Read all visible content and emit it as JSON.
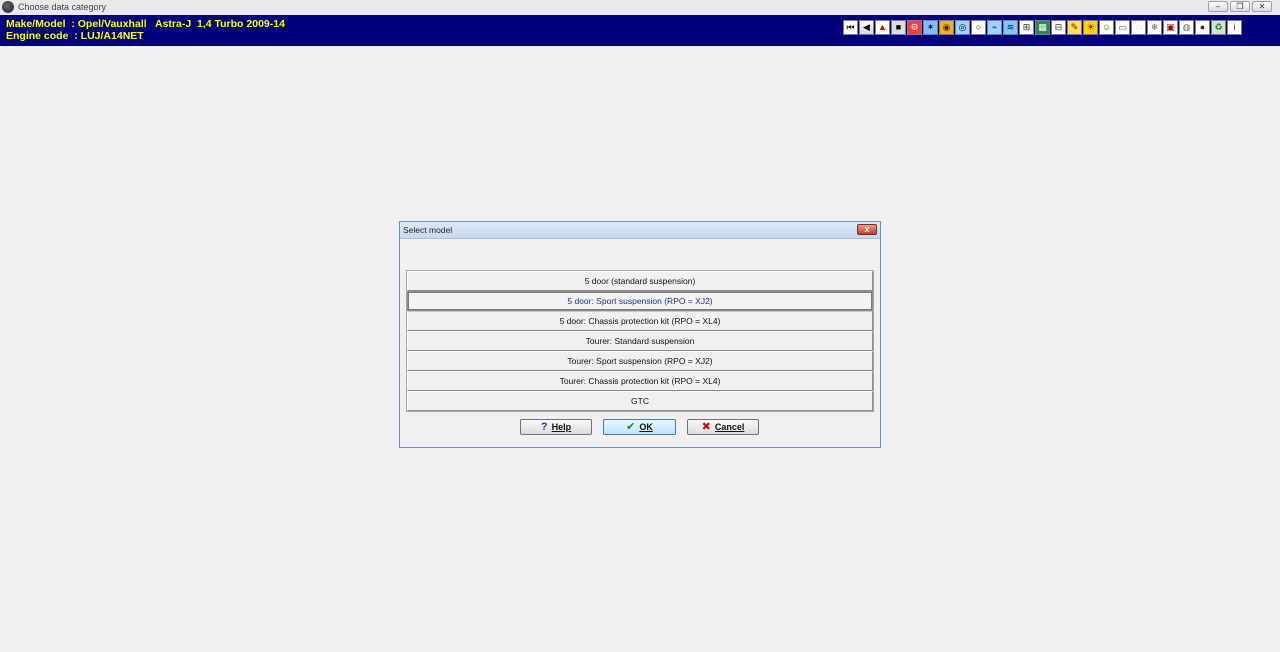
{
  "window": {
    "title": "Choose data category",
    "controls": [
      "minimize",
      "restore",
      "close"
    ]
  },
  "header": {
    "make_model_line": "Make/Model  : Opel/Vauxhall   Astra-J  1,4 Turbo 2009-14",
    "engine_code_line": "Engine code  : LUJ/A14NET"
  },
  "toolbar": {
    "icons": [
      "first-page-icon",
      "previous-icon",
      "warning-icon",
      "brakes-icon",
      "engine-icon",
      "ignition-icon",
      "fuel-icon",
      "wheel-icon",
      "cooling-icon",
      "electrical-icon",
      "oil-icon",
      "service-icon",
      "gearbox-icon",
      "timing-belt-icon",
      "diagnostics-icon",
      "lights-icon",
      "tyre-icon",
      "suspension-icon",
      "steering-icon",
      "aircon-icon",
      "battery-icon",
      "clutch-icon",
      "exhaust-icon",
      "emissions-icon",
      "info-icon"
    ]
  },
  "dialog": {
    "title": "Select model",
    "close_label": "x",
    "items": [
      "5 door (standard suspension)",
      "5 door: Sport suspension (RPO = XJ2)",
      "5 door: Chassis protection kit (RPO = XL4)",
      "Tourer: Standard suspension",
      "Tourer: Sport suspension (RPO = XJ2)",
      "Tourer: Chassis protection kit (RPO = XL4)",
      "GTC"
    ],
    "selected_index": 1,
    "buttons": {
      "help": "Help",
      "ok": "OK",
      "cancel": "Cancel"
    },
    "colors": {
      "selected_text": "#1b2fa0",
      "ok_icon": "#1a8a1a",
      "cancel_icon": "#c01010",
      "help_icon": "#1f3fa8"
    }
  }
}
